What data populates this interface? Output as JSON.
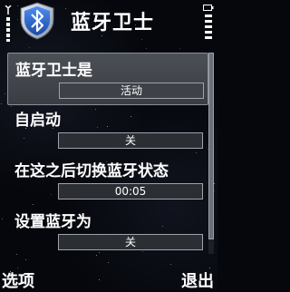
{
  "header": {
    "title": "蓝牙卫士",
    "app_icon": "bluetooth-shield-icon"
  },
  "settings": [
    {
      "label": "蓝牙卫士是",
      "value": "活动"
    },
    {
      "label": "自启动",
      "value": "关"
    },
    {
      "label": "在这之后切换蓝牙状态",
      "value": "00:05"
    },
    {
      "label": "设置蓝牙为",
      "value": "关"
    }
  ],
  "softkeys": {
    "left": "选项",
    "right": "退出"
  },
  "colors": {
    "focus_bg": "#4b4f56",
    "shield_blue": "#2f6fd1",
    "text": "#ffffff"
  }
}
